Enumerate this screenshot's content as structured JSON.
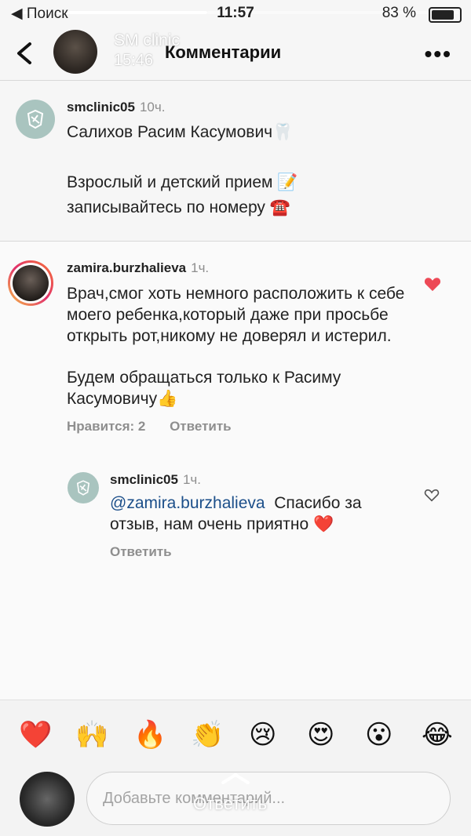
{
  "status_bar": {
    "carrier": "◀ Поиск",
    "time": "11:57",
    "battery": "83 %"
  },
  "header": {
    "clinic_name": "SM clinic",
    "clinic_time": "15:46",
    "title": "Комментарии"
  },
  "caption": {
    "username": "smclinic05",
    "time": "10ч.",
    "line1": "Салихов Расим Касумович🦷",
    "line2": "Взрослый и детский прием 📝",
    "line3": "записывайтесь по номеру ☎️"
  },
  "comment": {
    "username": "zamira.burzhalieva",
    "time": "1ч.",
    "text1": "Врач,смог хоть немного расположить к себе моего ребенка,который даже при просьбе открыть рот,никому не доверял и истерил.",
    "text2": "Будем обращаться только к Расиму Касумовичу👍",
    "likes": "Нравится: 2",
    "reply": "Ответить",
    "liked_color": "#ed4956"
  },
  "reply": {
    "username": "smclinic05",
    "time": "1ч.",
    "mention": "@zamira.burzhalieva",
    "text": "Спасибо за отзыв, нам очень приятно ❤️",
    "reply": "Ответить"
  },
  "emoji_bar": [
    "❤️",
    "🙌",
    "🔥",
    "👏",
    "😢",
    "😍",
    "😮",
    "😂"
  ],
  "input": {
    "placeholder": "Добавьте комментарий...",
    "overlay_label": "Ответить"
  }
}
